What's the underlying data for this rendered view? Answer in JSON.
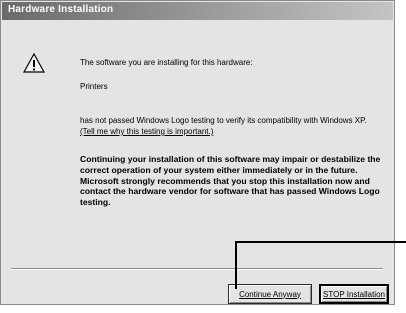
{
  "window": {
    "title": "Hardware Installation"
  },
  "message": {
    "intro": "The software you are installing for this hardware:",
    "product": "Printers",
    "notice": "has not passed Windows Logo testing to verify its compatibility with Windows XP.",
    "link": "(Tell me why this testing is important.)",
    "warning": "Continuing your installation of this software may impair or destabilize the correct operation of your system either immediately or in the future. Microsoft strongly recommends that you stop this installation now and contact the hardware vendor for software that has passed Windows Logo testing."
  },
  "buttons": {
    "continue_label": "Continue Anyway",
    "stop_label": "STOP Installation"
  },
  "icons": {
    "warning": "warning-icon"
  }
}
